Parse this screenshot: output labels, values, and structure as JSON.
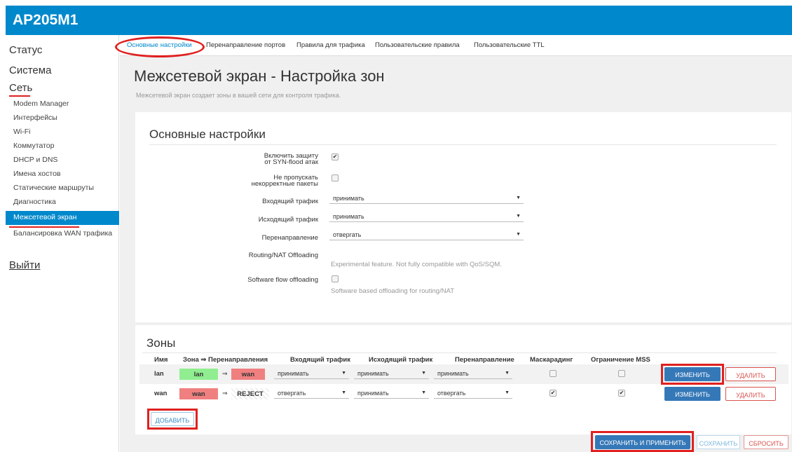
{
  "app": {
    "title": "AP205M1"
  },
  "sidebar": {
    "status": "Статус",
    "system": "Система",
    "network": "Сеть",
    "items": [
      "Modem Manager",
      "Интерфейсы",
      "Wi-Fi",
      "Коммутатор",
      "DHCP и DNS",
      "Имена хостов",
      "Статические маршруты",
      "Диагностика",
      "Межсетевой экран",
      "Балансировка WAN трафика"
    ],
    "logout": "Выйти"
  },
  "tabs": [
    "Основные настройки",
    "Перенаправление портов",
    "Правила для трафика",
    "Пользовательские правила",
    "Пользовательские TTL"
  ],
  "page": {
    "title": "Межсетевой экран - Настройка зон",
    "description": "Межсетевой экран создает зоны в вашей сети для контроля трафика."
  },
  "general": {
    "title": "Основные настройки",
    "syn_label_1": "Включить защиту",
    "syn_label_2": "от SYN-flood атак",
    "syn_checked": true,
    "drop_label_1": "Не пропускать",
    "drop_label_2": "некорректные пакеты",
    "drop_checked": false,
    "input_label": "Входящий трафик",
    "input_value": "принимать",
    "output_label": "Исходящий трафик",
    "output_value": "принимать",
    "forward_label": "Перенаправление",
    "forward_value": "отвергать",
    "nat_label": "Routing/NAT Offloading",
    "nat_hint": "Experimental feature. Not fully compatible with QoS/SQM.",
    "sw_label": "Software flow offloading",
    "sw_checked": false,
    "sw_hint": "Software based offloading for routing/NAT"
  },
  "zones": {
    "title": "Зоны",
    "headers": {
      "name": "Имя",
      "zone_forward": "Зона ⇒ Перенаправления",
      "input": "Входящий трафик",
      "output": "Исходящий трафик",
      "forward": "Перенаправление",
      "masq": "Маскарадинг",
      "mss": "Ограничение MSS"
    },
    "arrow": "⇒",
    "rows": [
      {
        "name": "lan",
        "zone": "lan",
        "target": "wan",
        "input": "принимать",
        "output": "принимать",
        "forward": "принимать",
        "masq": false,
        "mss": false
      },
      {
        "name": "wan",
        "zone": "wan",
        "target": "REJECT",
        "input": "отвергать",
        "output": "принимать",
        "forward": "отвергать",
        "masq": true,
        "mss": true
      }
    ],
    "edit_label": "ИЗМЕНИТЬ",
    "delete_label": "УДАЛИТЬ",
    "add_label": "ДОБАВИТЬ"
  },
  "footer": {
    "save_apply": "СОХРАНИТЬ И ПРИМЕНИТЬ",
    "save": "СОХРАНИТЬ",
    "reset": "СБРОСИТЬ"
  },
  "icons": {
    "dropdown": "chevron-down-icon",
    "checkmark": "check-icon"
  },
  "colors": {
    "brand": "#0088cc",
    "highlight": "#e0201f",
    "zone_lan": "#90ee90",
    "zone_wan": "#f08080"
  }
}
